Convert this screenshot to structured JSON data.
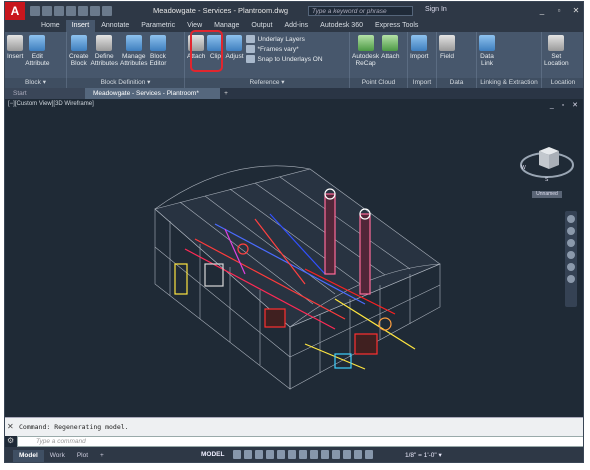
{
  "app": {
    "title": "Meadowgate - Services - Plantroom.dwg",
    "search_placeholder": "Type a keyword or phrase",
    "signin": "Sign In",
    "logo": "A"
  },
  "tabs": [
    "Home",
    "Insert",
    "Annotate",
    "Parametric",
    "View",
    "Manage",
    "Output",
    "Add-ins",
    "Autodesk 360",
    "Express Tools"
  ],
  "active_tab": "Insert",
  "ribbon": {
    "block_tools": [
      {
        "label": "Insert",
        "sub": "",
        "icon": "insert-block-icon"
      },
      {
        "label": "Edit",
        "sub": "Attribute",
        "icon": "edit-attribute-icon"
      },
      {
        "label": "Create",
        "sub": "Block",
        "icon": "create-block-icon"
      },
      {
        "label": "Define",
        "sub": "Attributes",
        "icon": "define-attributes-icon"
      },
      {
        "label": "Manage",
        "sub": "Attributes",
        "icon": "manage-attributes-icon"
      },
      {
        "label": "Block",
        "sub": "Editor",
        "icon": "block-editor-icon"
      }
    ],
    "reference_tools": [
      {
        "label": "Attach",
        "icon": "attach-icon"
      },
      {
        "label": "Clip",
        "icon": "clip-icon"
      },
      {
        "label": "Adjust",
        "icon": "adjust-icon"
      }
    ],
    "reference_small": [
      "Underlay Layers",
      "*Frames vary*",
      "Snap to Underlays ON"
    ],
    "pointcloud_tools": [
      {
        "label": "Autodesk",
        "sub": "ReCap",
        "icon": "recap-icon"
      },
      {
        "label": "Attach",
        "sub": "",
        "icon": "pointcloud-attach-icon"
      }
    ],
    "import_tool": {
      "label": "Import",
      "icon": "import-icon"
    },
    "data_tools": [
      {
        "label": "Field",
        "icon": "field-icon"
      }
    ],
    "linking_tools": [
      {
        "label": "Data",
        "sub": "Link",
        "icon": "data-link-icon"
      }
    ],
    "location_tool": {
      "label": "Set",
      "sub": "Location",
      "icon": "location-icon"
    },
    "panel_titles": [
      "Block ▾",
      "Block Definition ▾",
      "Reference ▾",
      "Point Cloud",
      "Import",
      "Data",
      "Linking & Extraction",
      "Location"
    ]
  },
  "doc_tabs": {
    "start": "Start",
    "active": "Meadowgate - Services - Plantroom*",
    "plus": "+"
  },
  "viewport": {
    "label": "[−][Custom View][3D Wireframe]",
    "controls": "_ ▫ ✕",
    "viewcube_label": "Unnamed"
  },
  "command": {
    "history": "Command:  Regenerating model.",
    "prompt": "Type a command",
    "close": "✕"
  },
  "status": {
    "tabs": [
      "Model",
      "Work",
      "Plot",
      "+"
    ],
    "active": "Model",
    "mode": "MODEL",
    "scale": "1/8\" = 1'-0\" ▾"
  },
  "colors": {
    "accent_red": "#e1262e",
    "bg_dark": "#1f2a36",
    "ribbon": "#47576c"
  }
}
